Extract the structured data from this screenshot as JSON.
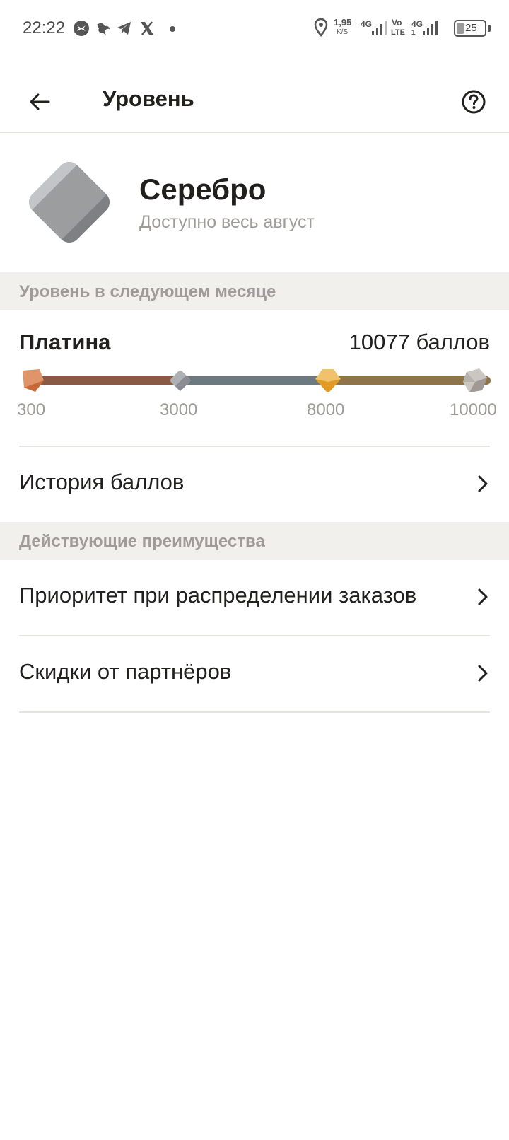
{
  "status_bar": {
    "time": "22:22",
    "net_speed_value": "1,95",
    "net_speed_unit": "K/S",
    "net_type_1": "4G",
    "volte_top": "Vo",
    "volte_bottom": "LTE",
    "net_type_2": "4G",
    "sim_index": "1",
    "battery": "25",
    "icons": [
      "app-icon",
      "bird-icon",
      "telegram-icon",
      "x-icon",
      "more-dot-icon",
      "location-icon",
      "signal-icon",
      "signal-icon",
      "battery-icon"
    ]
  },
  "header": {
    "title": "Уровень",
    "back_icon": "arrow-left-icon",
    "help_icon": "question-circle-icon"
  },
  "level": {
    "name": "Серебро",
    "subtitle": "Доступно весь август"
  },
  "next_month": {
    "section_title": "Уровень в следующем месяце",
    "level_name": "Платина",
    "points": "10077 баллов",
    "scale": [
      {
        "label": "300",
        "tier": "bronze",
        "color": "#c76a38"
      },
      {
        "label": "3000",
        "tier": "silver",
        "color": "#8a8e93"
      },
      {
        "label": "8000",
        "tier": "gold",
        "color": "#e09a25"
      },
      {
        "label": "10000",
        "tier": "platinum",
        "color": "#a19a94"
      }
    ],
    "segment_colors": [
      "#8a5a44",
      "#6c7a80",
      "#8e7448"
    ]
  },
  "history": {
    "label": "История баллов"
  },
  "benefits": {
    "section_title": "Действующие преимущества",
    "items": [
      {
        "label": "Приоритет при распределении заказов"
      },
      {
        "label": "Скидки от партнёров"
      }
    ]
  }
}
